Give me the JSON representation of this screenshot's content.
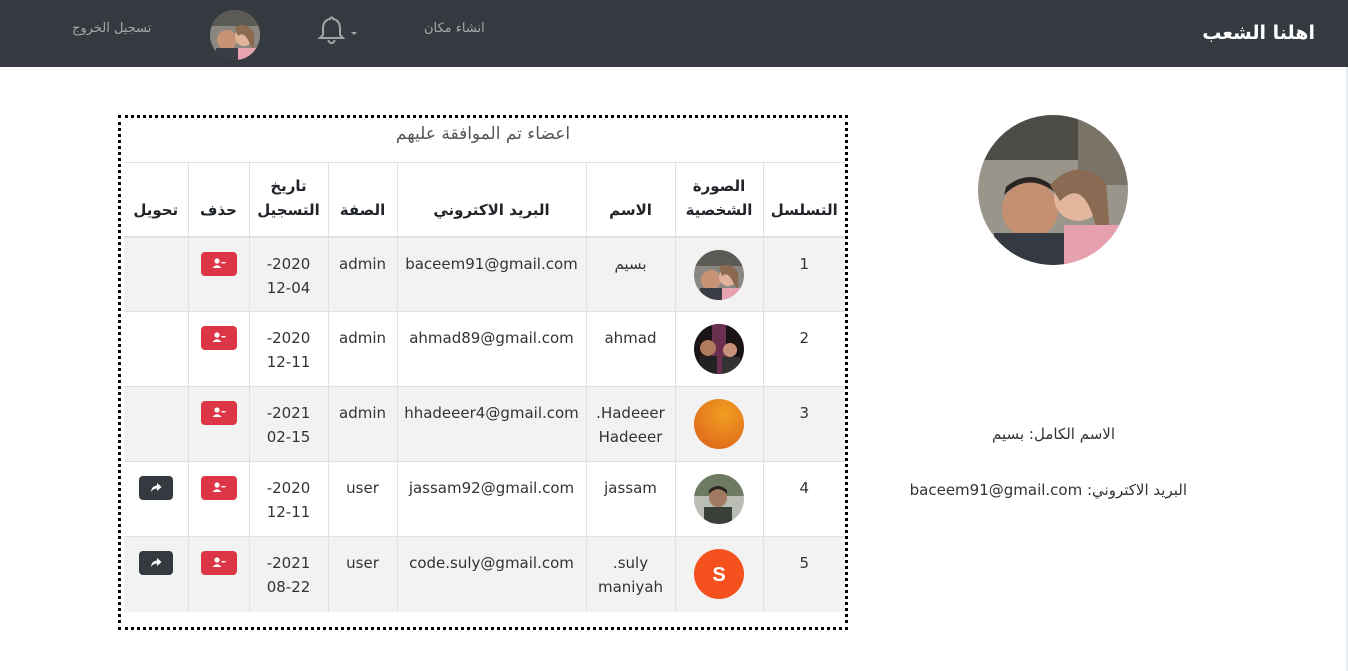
{
  "navbar": {
    "brand": "اهلنا الشعب",
    "create_place": "انشاء مكان",
    "logout": "تسجيل الخروج",
    "bell_icon": "bell-icon",
    "avatar_icon": "user-photo"
  },
  "panel": {
    "title": "اعضاء تم الموافقة عليهم",
    "headers": {
      "serial": "التسلسل",
      "photo_1": "الصورة",
      "photo_2": "الشخصية",
      "name": "الاسم",
      "email": "البريد الاكتروني",
      "role": "الصفة",
      "date_1": "تاريخ",
      "date_2": "التسجيل",
      "delete": "حذف",
      "transfer": "تحويل"
    },
    "rows": [
      {
        "serial": "1",
        "name_1": "بسيم",
        "name_2": "",
        "email": "baceem91@gmail.com",
        "role": "admin",
        "date_1": "2020-",
        "date_2": "12-04",
        "photo": "photo-couple",
        "transfer": false
      },
      {
        "serial": "2",
        "name_1": "ahmad",
        "name_2": "",
        "email": "ahmad89@gmail.com",
        "role": "admin",
        "date_1": "2020-",
        "date_2": "12-11",
        "photo": "photo-group",
        "transfer": false
      },
      {
        "serial": "3",
        "name_1": "Hadeeer.",
        "name_2": "Hadeeer",
        "email": "hhadeeer4@gmail.com",
        "role": "admin",
        "date_1": "2021-",
        "date_2": "02-15",
        "photo": "orange-circle",
        "transfer": false
      },
      {
        "serial": "4",
        "name_1": "jassam",
        "name_2": "",
        "email": "jassam92@gmail.com",
        "role": "user",
        "date_1": "2020-",
        "date_2": "12-11",
        "photo": "photo-man",
        "transfer": true
      },
      {
        "serial": "5",
        "name_1": "suly.",
        "name_2": "maniyah",
        "email": "code.suly@gmail.com",
        "role": "user",
        "date_1": "2021-",
        "date_2": "08-22",
        "photo": "letter-s",
        "photo_letter": "S",
        "transfer": true
      }
    ]
  },
  "profile": {
    "full_name_label": "الاسم الكامل:",
    "full_name": "بسيم",
    "email_label": "البريد الاكتروني:",
    "email": "baceem91@gmail.com"
  },
  "colors": {
    "navbar": "#343a40",
    "delete_button": "#dc3545",
    "transfer_button": "#343a40",
    "avatar_s": "#f4511e",
    "avatar_orange": "#e8891e"
  }
}
